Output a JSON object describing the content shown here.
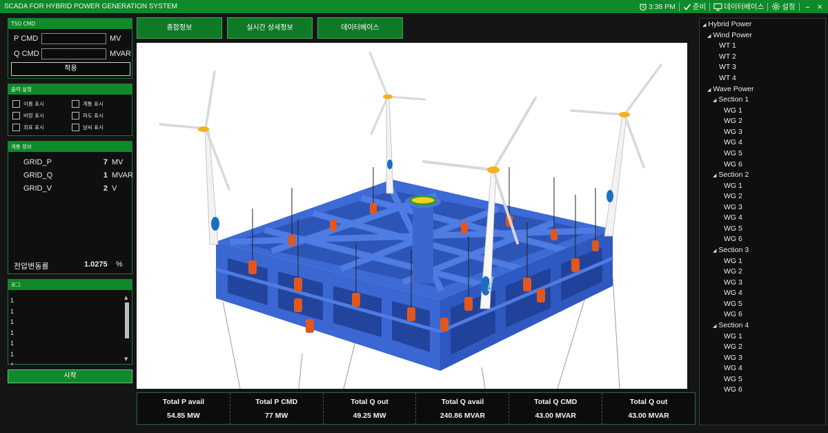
{
  "app": {
    "title": "SCADA FOR HYBRID POWER GENERATION SYSTEM"
  },
  "titlebar": {
    "time": "3:38 PM",
    "ready": "준비",
    "database": "데이터베이스",
    "settings": "설정",
    "minimize": "–",
    "close": "×"
  },
  "tso": {
    "header": "TSO CMD",
    "p_label": "P CMD",
    "p_value": "",
    "p_unit": "MV",
    "q_label": "Q CMD",
    "q_value": "",
    "q_unit": "MVAR",
    "apply": "적용"
  },
  "output": {
    "header": "출력 설정",
    "checks": [
      "이름 표시",
      "계통 표시",
      "바람 표시",
      "파도 표시",
      "좌표 표시",
      "날씨 표시"
    ]
  },
  "grid": {
    "header": "계통 정보",
    "rows": [
      {
        "label": "GRID_P",
        "value": "7",
        "unit": "MV"
      },
      {
        "label": "GRID_Q",
        "value": "1",
        "unit": "MVAR"
      },
      {
        "label": "GRID_V",
        "value": "2",
        "unit": "V"
      }
    ],
    "voltage_label": "전압변동률",
    "voltage_value": "1.0275",
    "voltage_unit": "%"
  },
  "log": {
    "header": "로그",
    "lines": [
      "1",
      "1",
      "1",
      "1",
      "1",
      "1",
      "1"
    ]
  },
  "start_button": "시작",
  "tabs": [
    "종합정보",
    "실시간 상세정보",
    "데이터베이스"
  ],
  "viewport": {
    "logo": "KRISO"
  },
  "stats": [
    {
      "label": "Total P avail",
      "value": "54.85 MW"
    },
    {
      "label": "Total P CMD",
      "value": "77 MW"
    },
    {
      "label": "Total Q out",
      "value": "49.25 MW"
    },
    {
      "label": "Total Q avail",
      "value": "240.86 MVAR"
    },
    {
      "label": "Total Q CMD",
      "value": "43.00 MVAR"
    },
    {
      "label": "Total Q out",
      "value": "43.00 MVAR"
    }
  ],
  "tree": {
    "root": "Hybrid Power",
    "wind": {
      "label": "Wind Power",
      "items": [
        "WT 1",
        "WT 2",
        "WT 3",
        "WT 4"
      ]
    },
    "wave": {
      "label": "Wave Power",
      "sections": [
        {
          "label": "Section 1",
          "items": [
            "WG 1",
            "WG 2",
            "WG 3",
            "WG 4",
            "WG 5",
            "WG 6"
          ]
        },
        {
          "label": "Section 2",
          "items": [
            "WG 1",
            "WG 2",
            "WG 3",
            "WG 4",
            "WG 5",
            "WG 6"
          ]
        },
        {
          "label": "Section 3",
          "items": [
            "WG 1",
            "WG 2",
            "WG 3",
            "WG 4",
            "WG 5",
            "WG 6"
          ]
        },
        {
          "label": "Section 4",
          "items": [
            "WG 1",
            "WG 2",
            "WG 3",
            "WG 4",
            "WG 5",
            "WG 6"
          ]
        }
      ]
    }
  },
  "colors": {
    "accent": "#0e8a2a",
    "platform": "#3f6fd6",
    "background": "#151515"
  }
}
